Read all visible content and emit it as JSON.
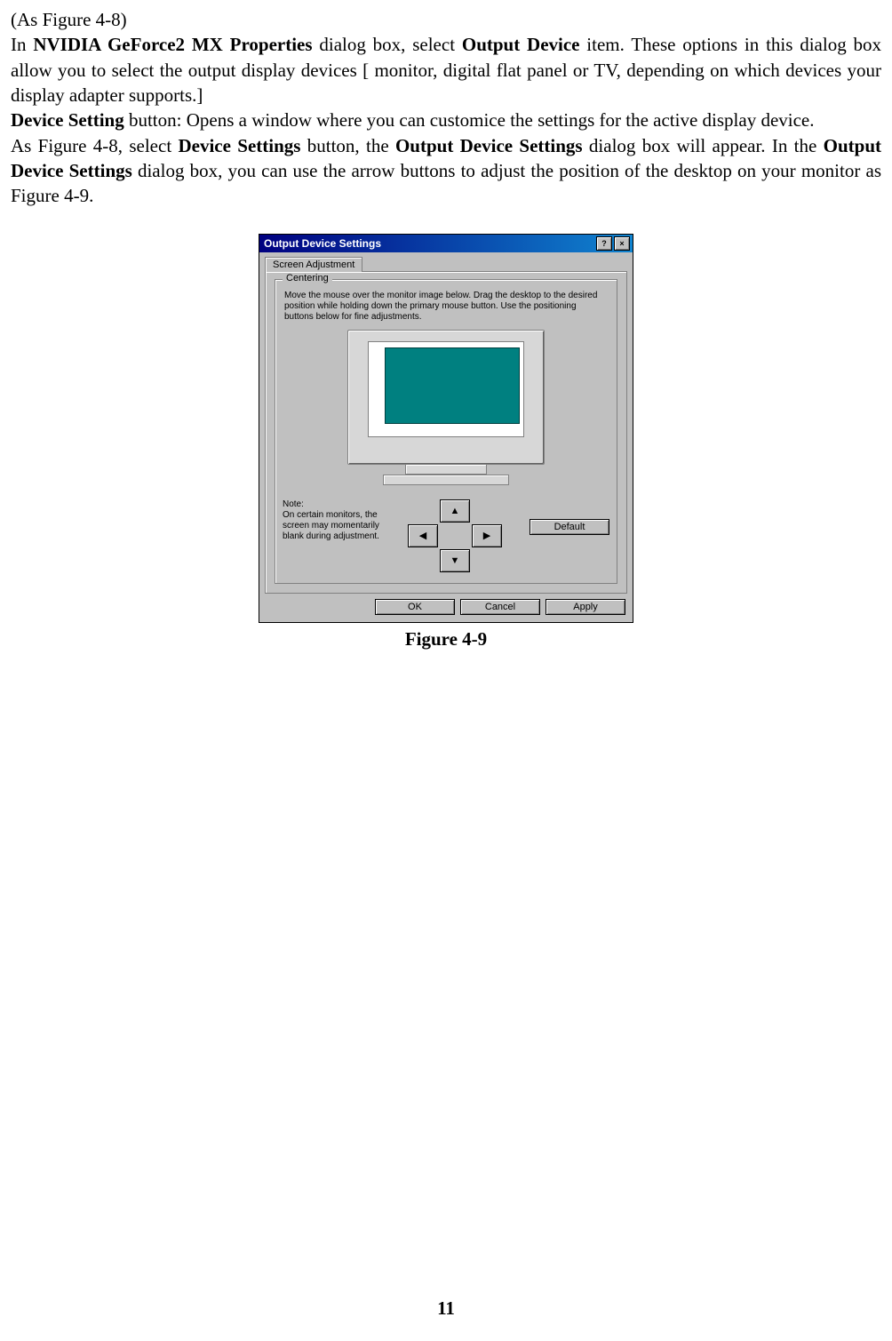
{
  "doc": {
    "line1": "(As Figure 4-8)",
    "para1_a": "In ",
    "para1_b_bold": "NVIDIA GeForce2 MX Properties",
    "para1_c": " dialog box, select ",
    "para1_d_bold": "Output Device",
    "para1_e": " item. These options in this dialog box allow you to select the output display devices [ monitor, digital flat panel or TV, depending on which devices your display adapter supports.]",
    "para2_a_bold": "Device Setting",
    "para2_b": " button: Opens a window where you can customice the settings for the active display device.",
    "para3_a": "As Figure 4-8, select ",
    "para3_b_bold": "Device Settings",
    "para3_c": " button, the ",
    "para3_d_bold": "Output Device Settings",
    "para3_e": " dialog box will appear.   In the ",
    "para3_f_bold": "Output Device Settings",
    "para3_g": " dialog box, you can use the arrow buttons to adjust the position of the desktop on your monitor as Figure 4-9.",
    "figure_caption": "Figure 4-9",
    "page_number": "11"
  },
  "dialog": {
    "title": "Output Device Settings",
    "help_glyph": "?",
    "close_glyph": "×",
    "tab_label": "Screen Adjustment",
    "group_legend": "Centering",
    "instructions": "Move the mouse over the monitor image below. Drag the desktop to the desired position while holding down the primary mouse button. Use the positioning buttons below for fine adjustments.",
    "note_label": "Note:",
    "note_text": "On certain monitors, the screen may momentarily blank during adjustment.",
    "arrow_up": "▲",
    "arrow_down": "▼",
    "arrow_left": "◀",
    "arrow_right": "▶",
    "default_btn": "Default",
    "ok_btn": "OK",
    "cancel_btn": "Cancel",
    "apply_btn": "Apply"
  }
}
